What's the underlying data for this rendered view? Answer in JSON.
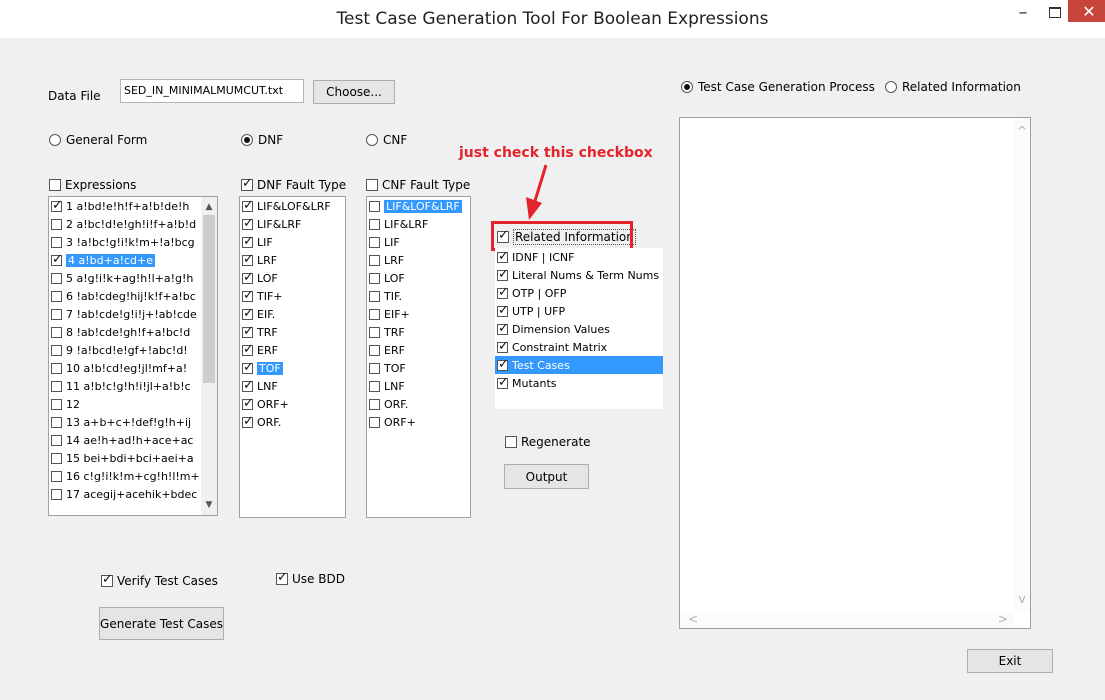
{
  "window": {
    "title": "Test Case Generation Tool  For Boolean Expressions"
  },
  "data_file": {
    "label": "Data File",
    "value": "SED_IN_MINIMALMUMCUT.txt",
    "choose_label": "Choose..."
  },
  "forms": [
    {
      "label": "General Form",
      "selected": false
    },
    {
      "label": "DNF",
      "selected": true
    },
    {
      "label": "CNF",
      "selected": false
    }
  ],
  "expressions": {
    "header": "Expressions",
    "items": [
      {
        "text": "1 a!bd!e!h!f+a!b!de!h",
        "checked": true,
        "selected": false
      },
      {
        "text": "2 a!bc!d!e!gh!i!f+a!b!d",
        "checked": false,
        "selected": false
      },
      {
        "text": "3 !a!bc!g!i!k!m+!a!bcg",
        "checked": false,
        "selected": false
      },
      {
        "text": "4 a!bd+a!cd+e",
        "checked": true,
        "selected": true
      },
      {
        "text": "5 a!g!i!k+ag!h!l+a!g!h",
        "checked": false,
        "selected": false
      },
      {
        "text": "6 !ab!cdeg!hij!k!f+a!bc",
        "checked": false,
        "selected": false
      },
      {
        "text": "7 !ab!cde!g!i!j+!ab!cde",
        "checked": false,
        "selected": false
      },
      {
        "text": "8 !ab!cde!gh!f+a!bc!d",
        "checked": false,
        "selected": false
      },
      {
        "text": "9 !a!bcd!e!gf+!abc!d!",
        "checked": false,
        "selected": false
      },
      {
        "text": "10 a!b!cd!eg!jl!mf+a!",
        "checked": false,
        "selected": false
      },
      {
        "text": "11 a!b!c!g!h!i!jl+a!b!c",
        "checked": false,
        "selected": false
      },
      {
        "text": "12",
        "checked": false,
        "selected": false
      },
      {
        "text": "13 a+b+c+!def!g!h+ij",
        "checked": false,
        "selected": false
      },
      {
        "text": "14 ae!h+ad!h+ace+ac",
        "checked": false,
        "selected": false
      },
      {
        "text": "15 bei+bdi+bci+aei+a",
        "checked": false,
        "selected": false
      },
      {
        "text": "16 c!g!i!k!m+cg!h!l!m+",
        "checked": false,
        "selected": false
      },
      {
        "text": "17 acegij+acehik+bdec",
        "checked": false,
        "selected": false
      }
    ]
  },
  "dnf_faults": {
    "header": "DNF Fault Type",
    "header_checked": true,
    "items": [
      {
        "text": "LIF&LOF&LRF",
        "checked": true,
        "selected": false
      },
      {
        "text": "LIF&LRF",
        "checked": true,
        "selected": false
      },
      {
        "text": "LIF",
        "checked": true,
        "selected": false
      },
      {
        "text": "LRF",
        "checked": true,
        "selected": false
      },
      {
        "text": "LOF",
        "checked": true,
        "selected": false
      },
      {
        "text": "TIF+",
        "checked": true,
        "selected": false
      },
      {
        "text": "EIF.",
        "checked": true,
        "selected": false
      },
      {
        "text": "TRF",
        "checked": true,
        "selected": false
      },
      {
        "text": "ERF",
        "checked": true,
        "selected": false
      },
      {
        "text": "TOF",
        "checked": true,
        "selected": true
      },
      {
        "text": "LNF",
        "checked": true,
        "selected": false
      },
      {
        "text": "ORF+",
        "checked": true,
        "selected": false
      },
      {
        "text": "ORF.",
        "checked": true,
        "selected": false
      }
    ]
  },
  "cnf_faults": {
    "header": "CNF Fault Type",
    "header_checked": false,
    "items": [
      {
        "text": "LIF&LOF&LRF",
        "checked": false,
        "selected": true
      },
      {
        "text": "LIF&LRF",
        "checked": false,
        "selected": false
      },
      {
        "text": "LIF",
        "checked": false,
        "selected": false
      },
      {
        "text": "LRF",
        "checked": false,
        "selected": false
      },
      {
        "text": "LOF",
        "checked": false,
        "selected": false
      },
      {
        "text": "TIF.",
        "checked": false,
        "selected": false
      },
      {
        "text": "EIF+",
        "checked": false,
        "selected": false
      },
      {
        "text": "TRF",
        "checked": false,
        "selected": false
      },
      {
        "text": "ERF",
        "checked": false,
        "selected": false
      },
      {
        "text": "TOF",
        "checked": false,
        "selected": false
      },
      {
        "text": "LNF",
        "checked": false,
        "selected": false
      },
      {
        "text": "ORF.",
        "checked": false,
        "selected": false
      },
      {
        "text": "ORF+",
        "checked": false,
        "selected": false
      }
    ]
  },
  "annotation": {
    "text": "just check this checkbox",
    "color": "#e3242b"
  },
  "related": {
    "header": "Related Information",
    "header_checked": true,
    "items": [
      {
        "text": "IDNF | ICNF",
        "checked": true,
        "selected": false
      },
      {
        "text": "Literal Nums & Term Nums",
        "checked": true,
        "selected": false
      },
      {
        "text": "OTP | OFP",
        "checked": true,
        "selected": false
      },
      {
        "text": "UTP | UFP",
        "checked": true,
        "selected": false
      },
      {
        "text": "Dimension Values",
        "checked": true,
        "selected": false
      },
      {
        "text": "Constraint Matrix",
        "checked": true,
        "selected": false
      },
      {
        "text": "Test Cases",
        "checked": true,
        "selected": true
      },
      {
        "text": "Mutants",
        "checked": true,
        "selected": false
      }
    ]
  },
  "regenerate": {
    "label": "Regenerate",
    "checked": false
  },
  "output_button": "Output",
  "view_mode": [
    {
      "label": "Test Case Generation Process",
      "selected": true
    },
    {
      "label": "Related Information",
      "selected": false
    }
  ],
  "verify": {
    "label": "Verify Test Cases",
    "checked": true
  },
  "use_bdd": {
    "label": "Use BDD",
    "checked": true
  },
  "generate_button": "Generate Test Cases",
  "exit_button": "Exit",
  "colors": {
    "selection": "#3399ff",
    "close_button": "#c7463b",
    "highlight": "#e3242b"
  }
}
